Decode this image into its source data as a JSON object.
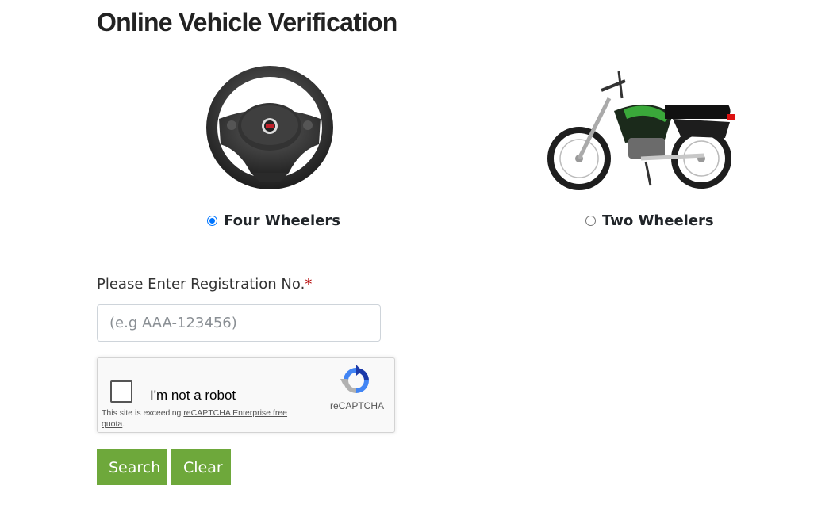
{
  "page": {
    "title": "Online Vehicle Verification"
  },
  "vehicle_types": [
    {
      "label": "Four Wheelers",
      "selected": true,
      "icon": "steering-wheel-icon"
    },
    {
      "label": "Two Wheelers",
      "selected": false,
      "icon": "motorcycle-icon"
    }
  ],
  "form": {
    "registration_label": "Please Enter Registration No.",
    "required_mark": "*",
    "registration_placeholder": "(e.g AAA-123456)",
    "registration_value": ""
  },
  "captcha": {
    "label": "I'm not a robot",
    "note_prefix": "This site is exceeding ",
    "note_link": "reCAPTCHA Enterprise free quota",
    "note_suffix": ".",
    "brand": "reCAPTCHA",
    "checked": false
  },
  "buttons": {
    "search": "Search",
    "clear": "Clear"
  },
  "colors": {
    "button_bg": "#6ea83b",
    "radio_accent": "#0075ff",
    "required": "#b30000"
  }
}
